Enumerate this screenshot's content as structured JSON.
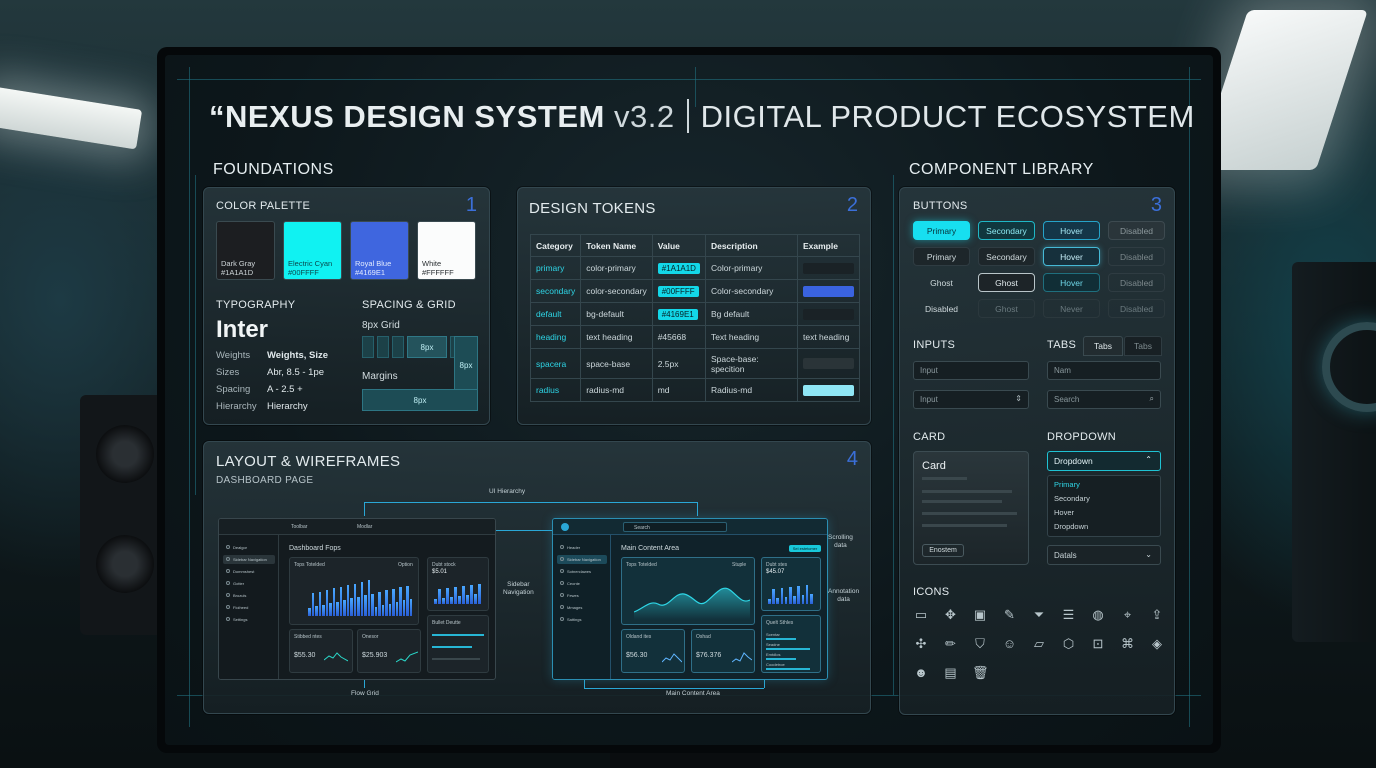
{
  "title": {
    "main": "“NEXUS DESIGN SYSTEM",
    "version": "v3.2",
    "subtitle": "DIGITAL PRODUCT ECOSYSTEM"
  },
  "sections": {
    "foundations": "FOUNDATIONS",
    "component_library": "COMPONENT LIBRARY"
  },
  "color_palette": {
    "title": "COLOR PALETTE",
    "number": "1",
    "swatches": [
      {
        "name": "Dark Gray",
        "hex": "#1A1A1D",
        "color": "#1c1e21",
        "text_color": "#cfd6d9"
      },
      {
        "name": "Electric Cyan",
        "hex": "#00FFFF",
        "color": "#10f2f2",
        "text_color": "#0a4a4f"
      },
      {
        "name": "Royal Blue",
        "hex": "#4169E1",
        "color": "#3f66df",
        "text_color": "#e3ecff"
      },
      {
        "name": "White",
        "hex": "#FFFFFF",
        "color": "#fbfcfc",
        "text_color": "#2b3033"
      }
    ]
  },
  "typography": {
    "title": "TYPOGRAPHY",
    "font": "Inter",
    "rows": [
      {
        "label": "Weights",
        "value": "Weights, Size"
      },
      {
        "label": "Sizes",
        "value": "Abr, 8.5 - 1pe"
      },
      {
        "label": "Spacing",
        "value": "A - 2.5 +"
      },
      {
        "label": "Hierarchy",
        "value": "Hierarchy"
      }
    ]
  },
  "spacing": {
    "title": "SPACING & GRID",
    "grid_label": "8px Grid",
    "grid_tag": "8px",
    "margins_label": "Margins",
    "side_tag": "8px",
    "bottom_tag": "8px"
  },
  "tokens": {
    "title": "DESIGN TOKENS",
    "number": "2",
    "headers": [
      "Category",
      "Token Name",
      "Value",
      "Description",
      "Example"
    ],
    "rows": [
      {
        "category": "primary",
        "token": "color-primary",
        "value": "#1A1A1D",
        "chip": true,
        "description": "Color-primary",
        "example": "#1a2226"
      },
      {
        "category": "secondary",
        "token": "color-secondary",
        "value": "#00FFFF",
        "chip": true,
        "description": "Color-secondary",
        "example": "#3a63e0"
      },
      {
        "category": "default",
        "token": "bg-default",
        "value": "#4169E1",
        "chip": true,
        "description": "Bg default",
        "example": "#1a2226"
      },
      {
        "category": "heading",
        "token": "text heading",
        "value": "#45668",
        "chip": false,
        "description": "Text heading",
        "example_text": "text heading"
      },
      {
        "category": "spacera",
        "token": "space-base",
        "value": "2.5px",
        "chip": false,
        "description": "Space-base: specition",
        "example": "#2a3438"
      },
      {
        "category": "radius",
        "token": "radius-md",
        "value": "md",
        "chip": false,
        "description": "Radius-md",
        "example": "#8fe6f5"
      }
    ]
  },
  "buttons": {
    "title": "BUTTONS",
    "number": "3",
    "rows": [
      [
        {
          "label": "Primary",
          "style": "b-pri"
        },
        {
          "label": "Secondary",
          "style": "b-sec"
        },
        {
          "label": "Hover",
          "style": "b-hov"
        },
        {
          "label": "Disabled",
          "style": "b-dis"
        }
      ],
      [
        {
          "label": "Primary",
          "style": "b-drk"
        },
        {
          "label": "Secondary",
          "style": "b-drk"
        },
        {
          "label": "Hover",
          "style": "b-hov2"
        },
        {
          "label": "Disabled",
          "style": "b-dis2"
        }
      ],
      [
        {
          "label": "Ghost",
          "style": "b-gh"
        },
        {
          "label": "Ghost",
          "style": "b-gho"
        },
        {
          "label": "Hover",
          "style": "b-hov3"
        },
        {
          "label": "Disabled",
          "style": "b-dis2"
        }
      ],
      [
        {
          "label": "Disabled",
          "style": "b-gh"
        },
        {
          "label": "Ghost",
          "style": "b-nev"
        },
        {
          "label": "Never",
          "style": "b-nev"
        },
        {
          "label": "Disabled",
          "style": "b-nev"
        }
      ]
    ]
  },
  "inputs": {
    "title": "INPUTS",
    "input1_placeholder": "Input",
    "input2_placeholder": "Input"
  },
  "tabs": {
    "title": "TABS",
    "items": [
      "Tabs",
      "Tabs"
    ],
    "name_placeholder": "Nam",
    "search_placeholder": "Search"
  },
  "card": {
    "title": "CARD",
    "card_title": "Card",
    "button": "Enostem"
  },
  "dropdown": {
    "title": "DROPDOWN",
    "selected": "Dropdown",
    "options": [
      "Primary",
      "Secondary",
      "Hover",
      "Dropdown"
    ],
    "details": "Datals"
  },
  "icons": {
    "title": "ICONS",
    "items": [
      {
        "name": "monitor-icon",
        "glyph": "▭"
      },
      {
        "name": "move-icon",
        "glyph": "✥"
      },
      {
        "name": "badge-icon",
        "glyph": "▣"
      },
      {
        "name": "pen-icon",
        "glyph": "✎"
      },
      {
        "name": "filter-icon",
        "glyph": "⏷"
      },
      {
        "name": "sliders-icon",
        "glyph": "☰"
      },
      {
        "name": "globe-icon",
        "glyph": "◍"
      },
      {
        "name": "location-pin-icon",
        "glyph": "⌖"
      },
      {
        "name": "share-icon",
        "glyph": "⇪"
      },
      {
        "name": "puzzle-icon",
        "glyph": "✣"
      },
      {
        "name": "pencil-icon",
        "glyph": "✏"
      },
      {
        "name": "shield-icon",
        "glyph": "⛉"
      },
      {
        "name": "user-icon",
        "glyph": "☺"
      },
      {
        "name": "folder-icon",
        "glyph": "▱"
      },
      {
        "name": "cube-icon",
        "glyph": "⬡"
      },
      {
        "name": "lock-icon",
        "glyph": "⊡"
      },
      {
        "name": "command-icon",
        "glyph": "⌘"
      },
      {
        "name": "layers-icon",
        "glyph": "◈"
      },
      {
        "name": "emoji-icon",
        "glyph": "☻"
      },
      {
        "name": "image-folder-icon",
        "glyph": "▤"
      },
      {
        "name": "trash-icon",
        "glyph": "🗑"
      }
    ]
  },
  "layout": {
    "title": "LAYOUT & WIREFRAMES",
    "number": "4",
    "subtitle": "DASHBOARD PAGE",
    "annotations": {
      "ui_hierarchy": "UI Hierarchy",
      "sidebar_navigation": "Sidebar\nNavigation",
      "flow_grid": "Flow Grid",
      "main_content_area": "Main Content Area",
      "scrolling_data": "Scrolling\ndata",
      "annotation_data": "Annotation\ndata"
    },
    "wf1": {
      "top_left": "Toolbar",
      "top_center": "Modlar",
      "heading": "Dashboard Fops",
      "chart_title": "Tops Totelded",
      "chart_dropdown": "Option",
      "side_title": "Dubt stock",
      "side_value": "$5.01",
      "stat1_title": "Stibbed ntes",
      "stat1_value": "$55.30",
      "stat2_title": "Onesor",
      "stat2_value": "$25.903",
      "list_title": "Bullet Deutte",
      "nav": [
        "Dealgor",
        "Sidebar Navigation",
        "Dommshest",
        "Gotter",
        "Brozuls",
        "Fioiheed",
        "Settings"
      ]
    },
    "wf2": {
      "search": "Search",
      "heading": "Main Content Area",
      "chart_title": "Tops Totelded",
      "chart_dropdown": "Stuple",
      "side_title": "Dubt stes",
      "side_value": "$45.07",
      "stat1_title": "Oldand ites",
      "stat1_value": "$56.30",
      "stat2_title": "Oshad",
      "stat2_value": "$76.376",
      "list_title": "Quelt Sthles",
      "list_items": [
        "Scentar",
        "Seadne",
        "Emtdlos",
        "Coodetroe"
      ],
      "badge": "Sel estetcmer",
      "nav": [
        "Header",
        "Sidebar Navigation",
        "Sotnerclawes",
        "Ceonte",
        "Fewes",
        "Mmages",
        "Sattings"
      ]
    }
  }
}
